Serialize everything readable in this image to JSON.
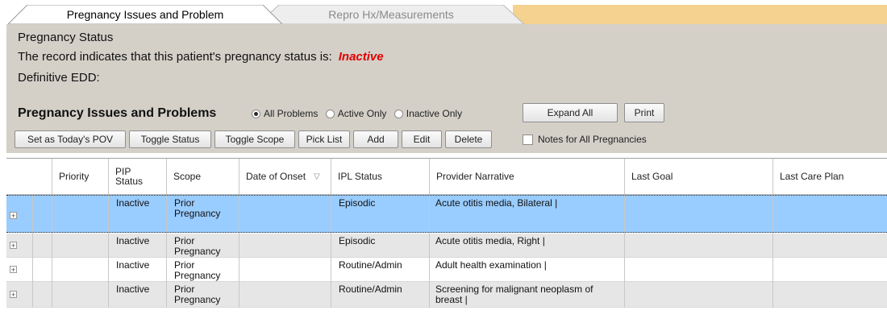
{
  "tabs": [
    {
      "label": "Pregnancy Issues and Problem",
      "active": true
    },
    {
      "label": "Repro Hx/Measurements",
      "active": false
    }
  ],
  "status": {
    "heading": "Pregnancy Status",
    "record_text": "The record indicates that this patient's pregnancy status is:",
    "status_value": "Inactive",
    "edd_label": "Definitive EDD:"
  },
  "pip": {
    "title": "Pregnancy Issues and Problems",
    "filters": [
      {
        "label": "All Problems",
        "selected": true
      },
      {
        "label": "Active Only",
        "selected": false
      },
      {
        "label": "Inactive Only",
        "selected": false
      }
    ],
    "expand_all_label": "Expand All",
    "print_label": "Print",
    "actions": [
      "Set as Today's POV",
      "Toggle Status",
      "Toggle Scope",
      "Pick List",
      "Add",
      "Edit",
      "Delete"
    ],
    "notes_checkbox_label": "Notes for All Pregnancies",
    "notes_checked": false
  },
  "grid": {
    "columns": [
      "Priority",
      "PIP Status",
      "Scope",
      "Date of Onset",
      "IPL Status",
      "Provider Narrative",
      "Last Goal",
      "Last Care Plan"
    ],
    "sort_icon": "sort-descending-icon",
    "rows": [
      {
        "priority": "",
        "pip_status": "Inactive",
        "scope": "Prior Pregnancy",
        "onset": "",
        "ipl_status": "Episodic",
        "narrative": "Acute otitis media, Bilateral |",
        "goal": "",
        "care_plan": "",
        "selected": true
      },
      {
        "priority": "",
        "pip_status": "Inactive",
        "scope": "Prior Pregnancy",
        "onset": "",
        "ipl_status": "Episodic",
        "narrative": "Acute otitis media, Right |",
        "goal": "",
        "care_plan": "",
        "selected": false
      },
      {
        "priority": "",
        "pip_status": "Inactive",
        "scope": "Prior Pregnancy",
        "onset": "",
        "ipl_status": "Routine/Admin",
        "narrative": "Adult health examination |",
        "goal": "",
        "care_plan": "",
        "selected": false
      },
      {
        "priority": "",
        "pip_status": "Inactive",
        "scope": "Prior Pregnancy",
        "onset": "",
        "ipl_status": "Routine/Admin",
        "narrative": "Screening for malignant neoplasm of breast |",
        "goal": "",
        "care_plan": "",
        "selected": false
      }
    ]
  },
  "colors": {
    "tab_strip": "#f5d28f",
    "panel": "#d4d0c8",
    "selected_row": "#99ccff",
    "alt_row": "#e6e6e6",
    "status_inactive": "#e00000"
  }
}
